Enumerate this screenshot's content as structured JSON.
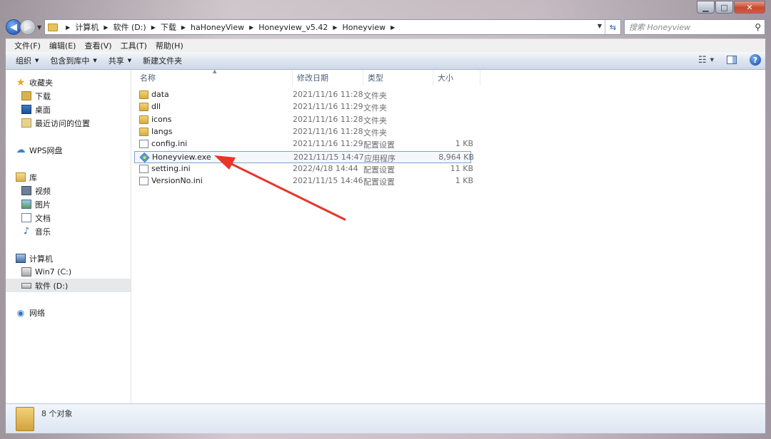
{
  "search": {
    "placeholder": "搜索 Honeyview"
  },
  "address": {
    "crumbs": [
      "计算机",
      "软件 (D:)",
      "下载",
      "haHoneyView",
      "Honeyview_v5.42",
      "Honeyview"
    ]
  },
  "menu": [
    "文件(F)",
    "编辑(E)",
    "查看(V)",
    "工具(T)",
    "帮助(H)"
  ],
  "commands": {
    "organize": "组织",
    "include": "包含到库中",
    "share": "共享",
    "new_folder": "新建文件夹"
  },
  "sidebar": {
    "items": [
      {
        "label": "收藏夹",
        "icon": "star-icon"
      },
      {
        "label": "下载",
        "icon": "downloads-folder-icon"
      },
      {
        "label": "桌面",
        "icon": "desktop-icon"
      },
      {
        "label": "最近访问的位置",
        "icon": "recent-places-icon"
      },
      {
        "label": "WPS网盘",
        "icon": "cloud-icon"
      },
      {
        "label": "库",
        "icon": "library-icon"
      },
      {
        "label": "视频",
        "icon": "video-icon"
      },
      {
        "label": "图片",
        "icon": "pictures-icon"
      },
      {
        "label": "文档",
        "icon": "documents-icon"
      },
      {
        "label": "音乐",
        "icon": "music-icon"
      },
      {
        "label": "计算机",
        "icon": "computer-icon"
      },
      {
        "label": "Win7 (C:)",
        "icon": "drive-c-icon"
      },
      {
        "label": "软件 (D:)",
        "icon": "drive-d-icon",
        "selected": true
      },
      {
        "label": "网络",
        "icon": "network-icon"
      }
    ]
  },
  "columns": {
    "name": "名称",
    "date": "修改日期",
    "type": "类型",
    "size": "大小"
  },
  "files": [
    {
      "name": "data",
      "date": "2021/11/16 11:28",
      "type": "文件夹",
      "size": "",
      "kind": "folder"
    },
    {
      "name": "dll",
      "date": "2021/11/16 11:29",
      "type": "文件夹",
      "size": "",
      "kind": "folder"
    },
    {
      "name": "icons",
      "date": "2021/11/16 11:28",
      "type": "文件夹",
      "size": "",
      "kind": "folder"
    },
    {
      "name": "langs",
      "date": "2021/11/16 11:28",
      "type": "文件夹",
      "size": "",
      "kind": "folder"
    },
    {
      "name": "config.ini",
      "date": "2021/11/16 11:29",
      "type": "配置设置",
      "size": "1 KB",
      "kind": "ini"
    },
    {
      "name": "Honeyview.exe",
      "date": "2021/11/15 14:47",
      "type": "应用程序",
      "size": "8,964 KB",
      "kind": "exe",
      "highlighted": true
    },
    {
      "name": "setting.ini",
      "date": "2022/4/18 14:44",
      "type": "配置设置",
      "size": "11 KB",
      "kind": "ini"
    },
    {
      "name": "VersionNo.ini",
      "date": "2021/11/15 14:46",
      "type": "配置设置",
      "size": "1 KB",
      "kind": "ini"
    }
  ],
  "status": {
    "text": "8 个对象"
  },
  "colors": {
    "arrow": "#e8362a",
    "selection_border": "#7da2ce"
  }
}
